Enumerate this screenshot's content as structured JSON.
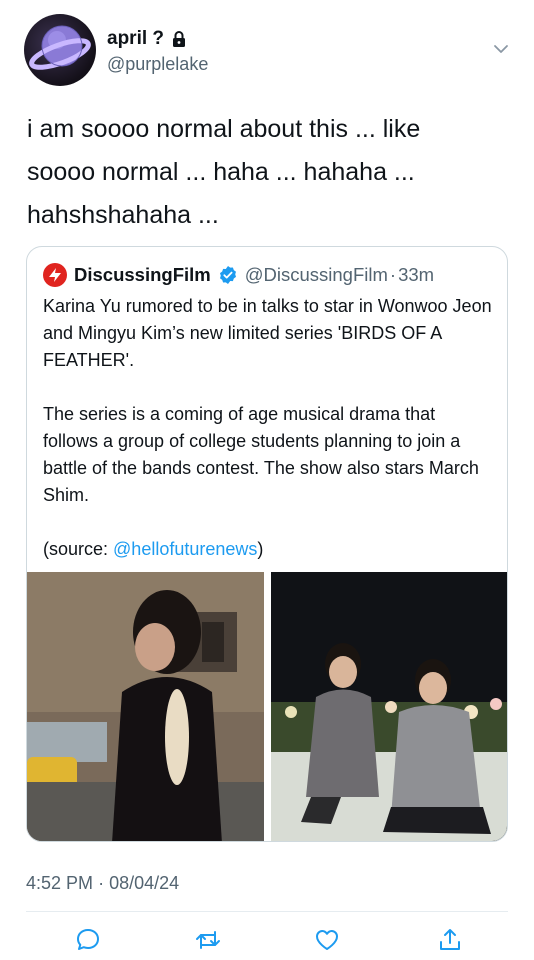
{
  "author": {
    "name": "april ?",
    "handle": "@purplelake",
    "avatar_icon": "planet-avatar",
    "lock_icon": "lock-icon"
  },
  "tweet": {
    "text": "i am soooo normal about this ... like\nsoooo normal ... haha ... hahaha ...\nhahshshahaha ..."
  },
  "quote": {
    "source_name": "DiscussingFilm",
    "source_handle": "@DiscussingFilm",
    "separator": "·",
    "time_ago": "33m",
    "paragraph1": "Karina Yu rumored to be in talks to star in Wonwoo Jeon and Mingyu Kim’s new limited series 'BIRDS OF A FEATHER'.",
    "paragraph2": "The series is a coming of age musical drama that follows a group of college students planning to join a battle of the bands contest. The show also stars March Shim.",
    "source_prefix": "(source: ",
    "source_link": "@hellofuturenews",
    "source_suffix": ")",
    "verified_color": "#1d9bf0",
    "logo_color": "#e0241f"
  },
  "timestamp": {
    "time": "4:52 PM",
    "separator": "·",
    "date": "08/04/24"
  },
  "actions": [
    "reply-icon",
    "retweet-icon",
    "like-icon",
    "share-icon"
  ]
}
